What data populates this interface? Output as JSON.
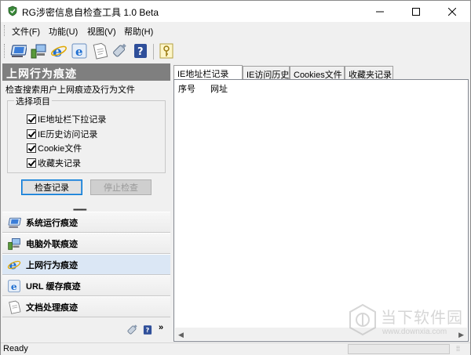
{
  "window": {
    "title": "RG涉密信息自检查工具 1.0 Beta"
  },
  "menu": [
    {
      "label": "文件(F)"
    },
    {
      "label": "功能(U)"
    },
    {
      "label": "视图(V)"
    },
    {
      "label": "帮助(H)"
    }
  ],
  "toolbar": {
    "icons": [
      "monitor-icon",
      "network-computer-icon",
      "ie-browser-icon",
      "ie-cache-icon",
      "document-icon",
      "usb-drive-icon",
      "help-icon",
      "key-icon"
    ]
  },
  "left_panel": {
    "header": "上网行为痕迹",
    "description": "检查搜索用户上网痕迹及行为文件",
    "group_title": "选择项目",
    "options": [
      {
        "label": "IE地址栏下拉记录",
        "checked": true
      },
      {
        "label": "IE历史访问记录",
        "checked": true
      },
      {
        "label": "Cookie文件",
        "checked": true
      },
      {
        "label": "收藏夹记录",
        "checked": true
      }
    ],
    "check_button": "检查记录",
    "stop_button": "停止检查",
    "nav": [
      {
        "label": "系统运行痕迹",
        "icon": "monitor-icon",
        "active": false
      },
      {
        "label": "电脑外联痕迹",
        "icon": "network-computer-icon",
        "active": false
      },
      {
        "label": "上网行为痕迹",
        "icon": "ie-browser-icon",
        "active": true
      },
      {
        "label": "URL 缓存痕迹",
        "icon": "ie-cache-icon",
        "active": false
      },
      {
        "label": "文档处理痕迹",
        "icon": "document-icon",
        "active": false
      }
    ]
  },
  "tabs": [
    {
      "label": "IE地址栏记录",
      "active": true
    },
    {
      "label": "IE访问历史",
      "active": false
    },
    {
      "label": "Cookies文件",
      "active": false
    },
    {
      "label": "收藏夹记录",
      "active": false
    }
  ],
  "list": {
    "columns": [
      "序号",
      "网址"
    ]
  },
  "watermark": {
    "text": "当下软件园",
    "url": "www.downxia.com"
  },
  "status": {
    "text": "Ready"
  },
  "colors": {
    "header_bg": "#7f7f7f",
    "active_nav": "#dbe7f5",
    "accent": "#0078d7"
  }
}
